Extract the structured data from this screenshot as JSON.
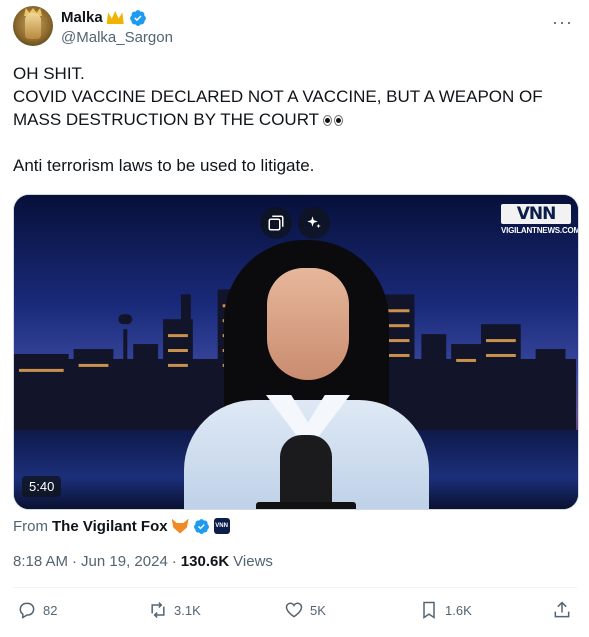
{
  "author": {
    "display_name": "Malka",
    "handle": "@Malka_Sargon",
    "crown_icon": "crown-emoji-icon",
    "verified_color": "#1d9bf0"
  },
  "tweet": {
    "line1": "OH SHIT.",
    "line2": "COVID VACCINE DECLARED NOT A VACCINE, BUT A WEAPON OF MASS DESTRUCTION BY THE COURT",
    "line3": "Anti terrorism laws to be used to litigate."
  },
  "media": {
    "duration": "5:40",
    "logo_mark": "VNN",
    "logo_site": "VIGILANTNEWS.COM"
  },
  "source": {
    "label": "From",
    "name": "The Vigilant Fox"
  },
  "meta": {
    "time": "8:18 AM",
    "separator": "·",
    "date": "Jun 19, 2024",
    "separator2": "·",
    "views_count": "130.6K",
    "views_label": "Views"
  },
  "actions": {
    "replies": "82",
    "reposts": "3.1K",
    "likes": "5K",
    "bookmarks": "1.6K"
  },
  "colors": {
    "text": "#0f1419",
    "secondary": "#536471",
    "accent": "#1d9bf0"
  }
}
